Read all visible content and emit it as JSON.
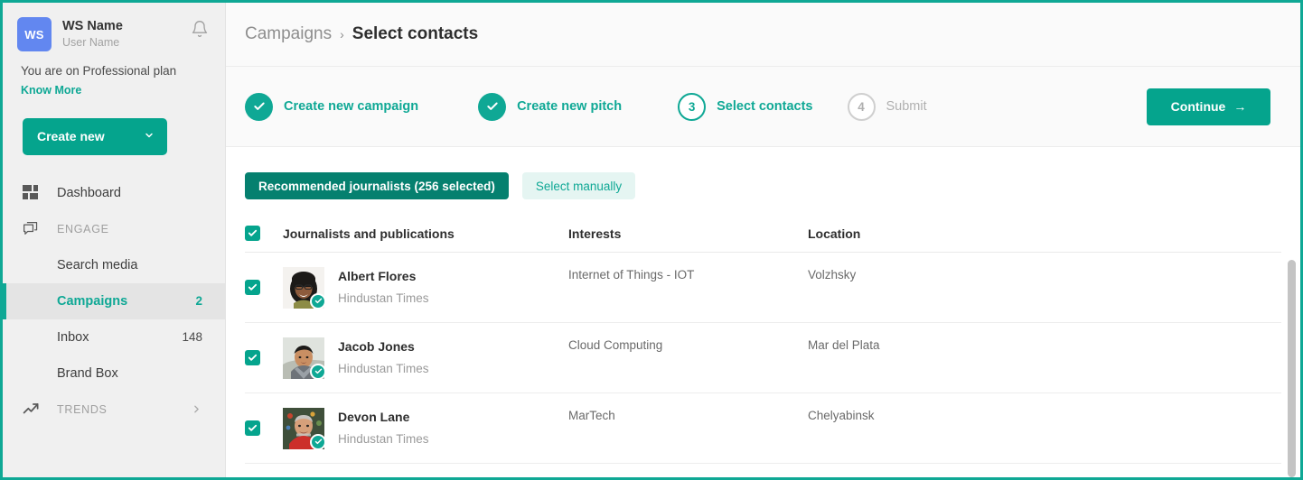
{
  "sidebar": {
    "workspace": {
      "initials": "WS",
      "name": "WS Name",
      "user": "User Name"
    },
    "bell_icon": "bell-icon",
    "plan": {
      "text": "You are on Professional plan",
      "link": "Know More"
    },
    "create_new": {
      "label": "Create new",
      "chevron": "chevron-down-icon"
    },
    "items": [
      {
        "label": "Dashboard",
        "icon": "dashboard-grid-icon",
        "count": "",
        "type": "main"
      },
      {
        "label": "ENGAGE",
        "icon": "chat-bubble-icon",
        "count": "",
        "type": "section"
      },
      {
        "label": "Search media",
        "icon": "",
        "count": "",
        "type": "sub"
      },
      {
        "label": "Campaigns",
        "icon": "",
        "count": "2",
        "type": "sub-active"
      },
      {
        "label": "Inbox",
        "icon": "",
        "count": "148",
        "type": "sub"
      },
      {
        "label": "Brand Box",
        "icon": "",
        "count": "",
        "type": "sub"
      },
      {
        "label": "TRENDS",
        "icon": "trend-up-icon",
        "count": "",
        "type": "section-expand"
      }
    ]
  },
  "breadcrumb": {
    "parent": "Campaigns",
    "separator": "›",
    "current": "Select contacts"
  },
  "stepper": {
    "steps": [
      {
        "marker": "✓",
        "label": "Create new campaign",
        "state": "done"
      },
      {
        "marker": "✓",
        "label": "Create new pitch",
        "state": "done"
      },
      {
        "marker": "3",
        "label": "Select contacts",
        "state": "current"
      },
      {
        "marker": "4",
        "label": "Submit",
        "state": "todo"
      }
    ],
    "continue": {
      "label": "Continue",
      "arrow": "→"
    }
  },
  "tabs": [
    {
      "label": "Recommended journalists (256 selected)",
      "selected": true
    },
    {
      "label": "Select manually",
      "selected": false
    }
  ],
  "table": {
    "select_all_checked": true,
    "columns": [
      "Journalists and publications",
      "Interests",
      "Location"
    ],
    "rows": [
      {
        "name": "Albert Flores",
        "publication": "Hindustan Times",
        "interests": "Internet of Things - IOT",
        "location": "Volzhsky",
        "checked": true,
        "verified": true,
        "avatar": "woman-glasses-avatar"
      },
      {
        "name": "Jacob Jones",
        "publication": "Hindustan Times",
        "interests": "Cloud Computing",
        "location": "Mar del Plata",
        "checked": true,
        "verified": true,
        "avatar": "man-outdoor-avatar"
      },
      {
        "name": "Devon Lane",
        "publication": "Hindustan Times",
        "interests": "MarTech",
        "location": "Chelyabinsk",
        "checked": true,
        "verified": true,
        "avatar": "man-red-shirt-avatar"
      }
    ]
  },
  "colors": {
    "accent": "#0fa895",
    "accent_dark": "#05806f",
    "avatar_blue": "#6287f0",
    "sidebar_bg": "#f0f0f0"
  }
}
